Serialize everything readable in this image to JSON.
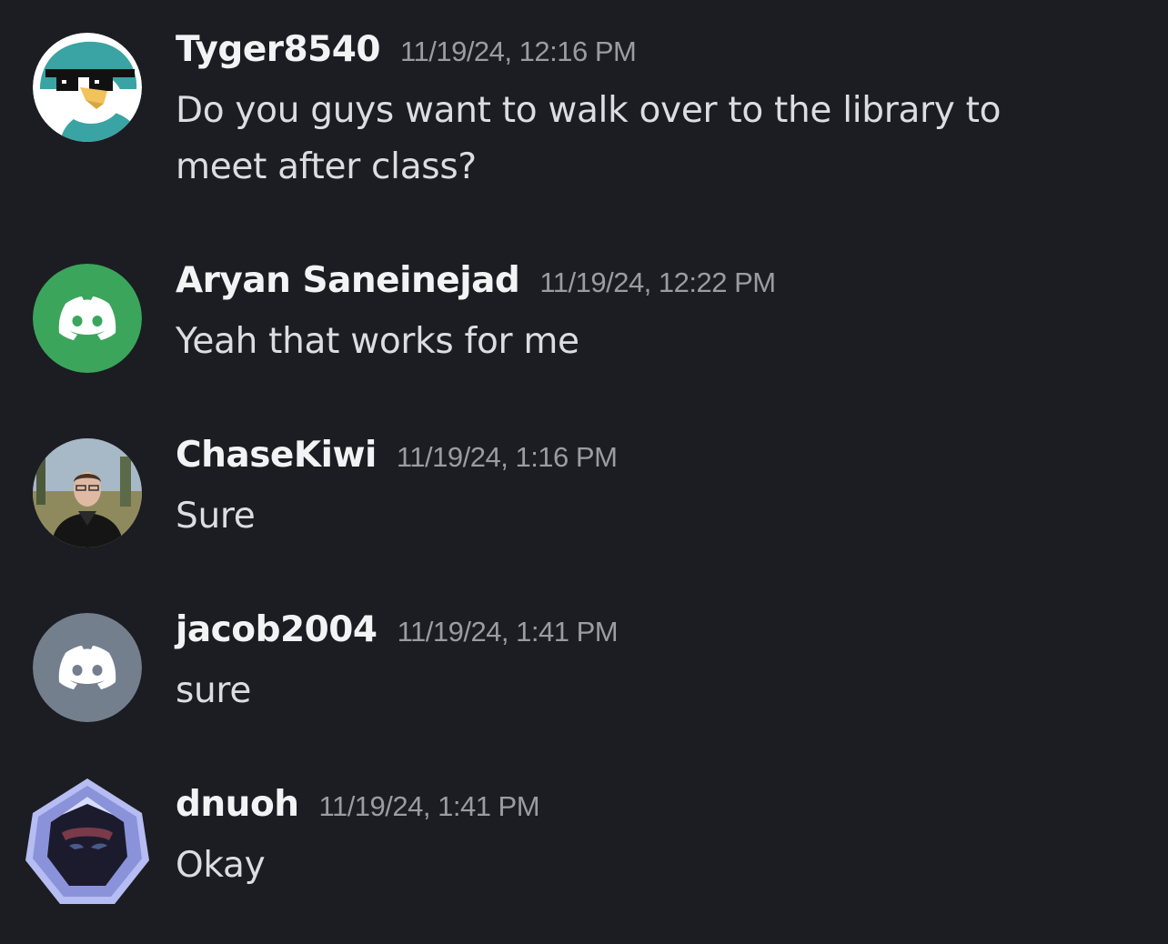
{
  "messages": [
    {
      "username": "Tyger8540",
      "timestamp": "11/19/24, 12:16 PM",
      "content": "Do you guys want to walk over to the library to meet after class?",
      "avatar": "penguin-sunglasses-avatar"
    },
    {
      "username": "Aryan Saneinejad",
      "timestamp": "11/19/24, 12:22 PM",
      "content": "Yeah that works for me",
      "avatar": "discord-default-avatar",
      "avatar_color": "#3ba55c"
    },
    {
      "username": "ChaseKiwi",
      "timestamp": "11/19/24, 1:16 PM",
      "content": "Sure",
      "avatar": "photo-avatar"
    },
    {
      "username": "jacob2004",
      "timestamp": "11/19/24, 1:41 PM",
      "content": "sure",
      "avatar": "discord-default-avatar",
      "avatar_color": "#747f8d"
    },
    {
      "username": "dnuoh",
      "timestamp": "11/19/24, 1:41 PM",
      "content": "Okay",
      "avatar": "hooded-figure-avatar"
    }
  ],
  "colors": {
    "background": "#1c1d22",
    "username": "#f2f3f5",
    "timestamp": "#9a9ca4",
    "content": "#dcdde1"
  }
}
